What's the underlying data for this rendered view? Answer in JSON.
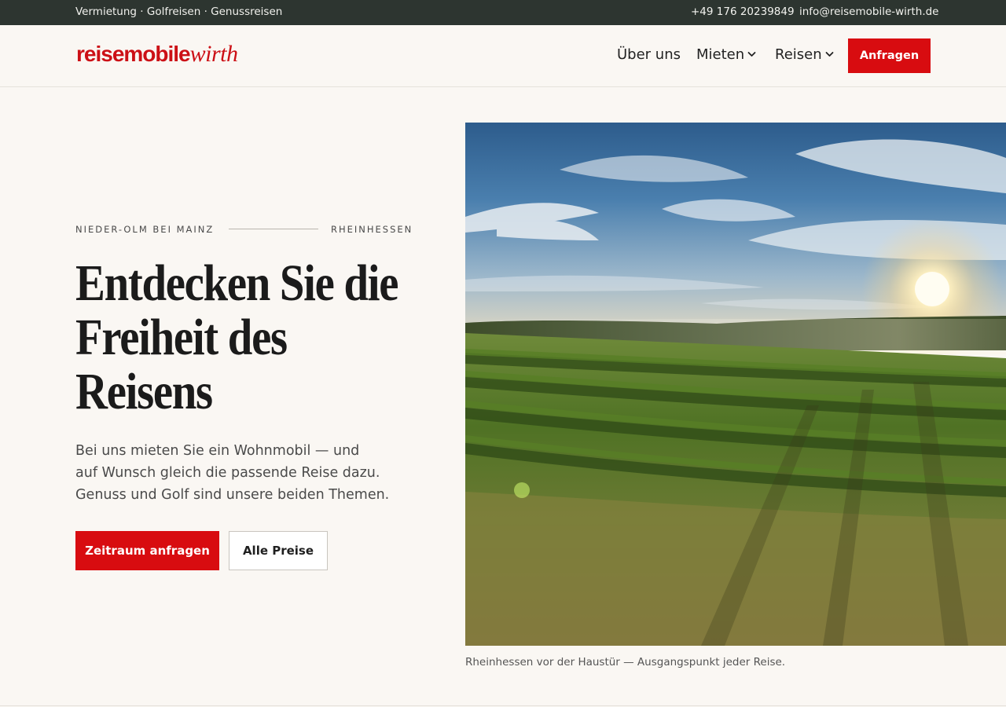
{
  "topbar": {
    "services": "Vermietung · Golfreisen · Genussreisen",
    "phone": "+49 176 20239849",
    "email": "info@reisemobile-wirth.de"
  },
  "header": {
    "logo_part1": "reisemobile",
    "logo_part2": "wirth",
    "nav": [
      {
        "label": "Über uns",
        "has_dropdown": false
      },
      {
        "label": "Mieten",
        "has_dropdown": true
      },
      {
        "label": "Reisen",
        "has_dropdown": true
      }
    ],
    "cta_label": "Anfragen"
  },
  "hero": {
    "eyebrow_left": "NIEDER-OLM BEI MAINZ",
    "eyebrow_right": "RHEINHESSEN",
    "headline_lines": [
      "Entdecken Sie die",
      "Freiheit des",
      "Reisens"
    ],
    "lead_lines": [
      "Bei uns mieten Sie ein Wohnmobil — und",
      "auf Wunsch gleich die passende Reise dazu.",
      "Genuss und Golf sind unsere beiden Themen."
    ],
    "primary_button": "Zeitraum anfragen",
    "secondary_button": "Alle Preise",
    "image_caption": "Rheinhessen vor der Haustür — Ausgangspunkt jeder Reise."
  },
  "colors": {
    "accent_red": "#d80c10",
    "topbar_bg": "#2d3530",
    "page_bg": "#faf7f3"
  },
  "icons": {
    "dropdown": "chevron-down-icon"
  }
}
